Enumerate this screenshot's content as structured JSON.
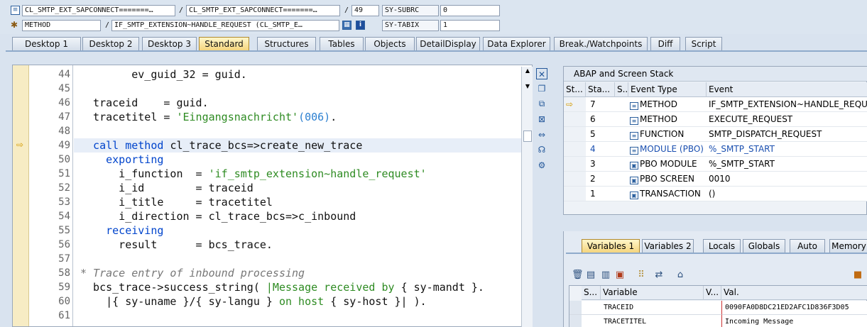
{
  "header": {
    "row1": {
      "program": "CL_SMTP_EXT_SAPCONNECT=======…",
      "include": "CL_SMTP_EXT_SAPCONNECT=======…",
      "line": "49",
      "sysfield_label": "SY-SUBRC",
      "sysfield_value": "0"
    },
    "row2": {
      "type": "METHOD",
      "event": "IF_SMTP_EXTENSION~HANDLE_REQUEST (CL_SMTP_E…",
      "sysfield_label": "SY-TABIX",
      "sysfield_value": "1"
    }
  },
  "tabs": [
    "Desktop 1",
    "Desktop 2",
    "Desktop 3",
    "Standard",
    "Structures",
    "Tables",
    "Objects",
    "DetailDisplay",
    "Data Explorer",
    "Break./Watchpoints",
    "Diff",
    "Script"
  ],
  "active_tab": "Standard",
  "editor": {
    "current_line": "49",
    "lines": [
      {
        "n": "44",
        "segs": [
          {
            "t": "        ev_guid_32 = guid.",
            "c": ""
          }
        ]
      },
      {
        "n": "45",
        "segs": [
          {
            "t": "",
            "c": ""
          }
        ]
      },
      {
        "n": "46",
        "segs": [
          {
            "t": "  traceid    = guid.",
            "c": ""
          }
        ]
      },
      {
        "n": "47",
        "segs": [
          {
            "t": "  tracetitel = ",
            "c": ""
          },
          {
            "t": "'Eingangsnachricht'",
            "c": "str"
          },
          {
            "t": "(006)",
            "c": "num"
          },
          {
            "t": ".",
            "c": ""
          }
        ]
      },
      {
        "n": "48",
        "segs": [
          {
            "t": "",
            "c": ""
          }
        ]
      },
      {
        "n": "49",
        "segs": [
          {
            "t": "  call method ",
            "c": "kw"
          },
          {
            "t": "cl_trace_bcs=>create_new_trace",
            "c": ""
          }
        ]
      },
      {
        "n": "50",
        "segs": [
          {
            "t": "    exporting",
            "c": "kw"
          }
        ]
      },
      {
        "n": "51",
        "segs": [
          {
            "t": "      i_function  = ",
            "c": ""
          },
          {
            "t": "'if_smtp_extension~handle_request'",
            "c": "str"
          }
        ]
      },
      {
        "n": "52",
        "segs": [
          {
            "t": "      i_id        = traceid",
            "c": ""
          }
        ]
      },
      {
        "n": "53",
        "segs": [
          {
            "t": "      i_title     = tracetitel",
            "c": ""
          }
        ]
      },
      {
        "n": "54",
        "segs": [
          {
            "t": "      i_direction = cl_trace_bcs=>c_inbound",
            "c": ""
          }
        ]
      },
      {
        "n": "55",
        "segs": [
          {
            "t": "    receiving",
            "c": "kw"
          }
        ]
      },
      {
        "n": "56",
        "segs": [
          {
            "t": "      result      = bcs_trace.",
            "c": ""
          }
        ]
      },
      {
        "n": "57",
        "segs": [
          {
            "t": "",
            "c": ""
          }
        ]
      },
      {
        "n": "58",
        "segs": [
          {
            "t": "* Trace entry of inbound processing",
            "c": "cmt"
          }
        ]
      },
      {
        "n": "59",
        "segs": [
          {
            "t": "  bcs_trace->success_string( ",
            "c": ""
          },
          {
            "t": "|Message received by ",
            "c": "str"
          },
          {
            "t": "{ sy-mandt }.",
            "c": ""
          }
        ]
      },
      {
        "n": "60",
        "segs": [
          {
            "t": "    |{ sy-uname }/{ sy-langu } ",
            "c": ""
          },
          {
            "t": "on host ",
            "c": "str"
          },
          {
            "t": "{ sy-host }| ).",
            "c": ""
          }
        ]
      },
      {
        "n": "61",
        "segs": [
          {
            "t": "",
            "c": ""
          }
        ]
      }
    ]
  },
  "side_buttons": [
    "close-icon",
    "new-window-icon",
    "copy-icon",
    "maximize-icon",
    "resize-icon",
    "link-icon",
    "settings-icon"
  ],
  "stack": {
    "title": "ABAP and Screen Stack",
    "columns": [
      "St...",
      "Sta...",
      "S..",
      "Event Type",
      "Event"
    ],
    "rows": [
      {
        "current": true,
        "level": "7",
        "type": "METHOD",
        "event": "IF_SMTP_EXTENSION~HANDLE_REQUE…",
        "blue": false
      },
      {
        "current": false,
        "level": "6",
        "type": "METHOD",
        "event": "EXECUTE_REQUEST",
        "blue": false
      },
      {
        "current": false,
        "level": "5",
        "type": "FUNCTION",
        "event": "SMTP_DISPATCH_REQUEST",
        "blue": false
      },
      {
        "current": false,
        "level": "4",
        "type": "MODULE (PBO)",
        "event": "%_SMTP_START",
        "blue": true
      },
      {
        "current": false,
        "level": "3",
        "type": "PBO MODULE",
        "event": "%_SMTP_START",
        "blue": false
      },
      {
        "current": false,
        "level": "2",
        "type": "PBO SCREEN",
        "event": "0010",
        "blue": false
      },
      {
        "current": false,
        "level": "1",
        "type": "TRANSACTION",
        "event": "()",
        "blue": false
      }
    ],
    "scroll_label": ":::"
  },
  "var_tabs": [
    "Variables 1",
    "Variables 2",
    "Locals",
    "Globals",
    "Auto",
    "Memory"
  ],
  "active_var_tab": "Variables 1",
  "variables": {
    "columns": [
      "S...",
      "Variable",
      "V...",
      "Val."
    ],
    "rows": [
      {
        "name": "TRACEID",
        "value": "0090FA0D8DC21ED2AFC1D836F3D05"
      },
      {
        "name": "TRACETITEL",
        "value": "Incoming Message"
      }
    ]
  },
  "colors": {
    "accent_tab": "#f4d37a",
    "highlight_line": "#e7eef8",
    "keyword": "#0044cc",
    "string": "#2e8b22"
  }
}
